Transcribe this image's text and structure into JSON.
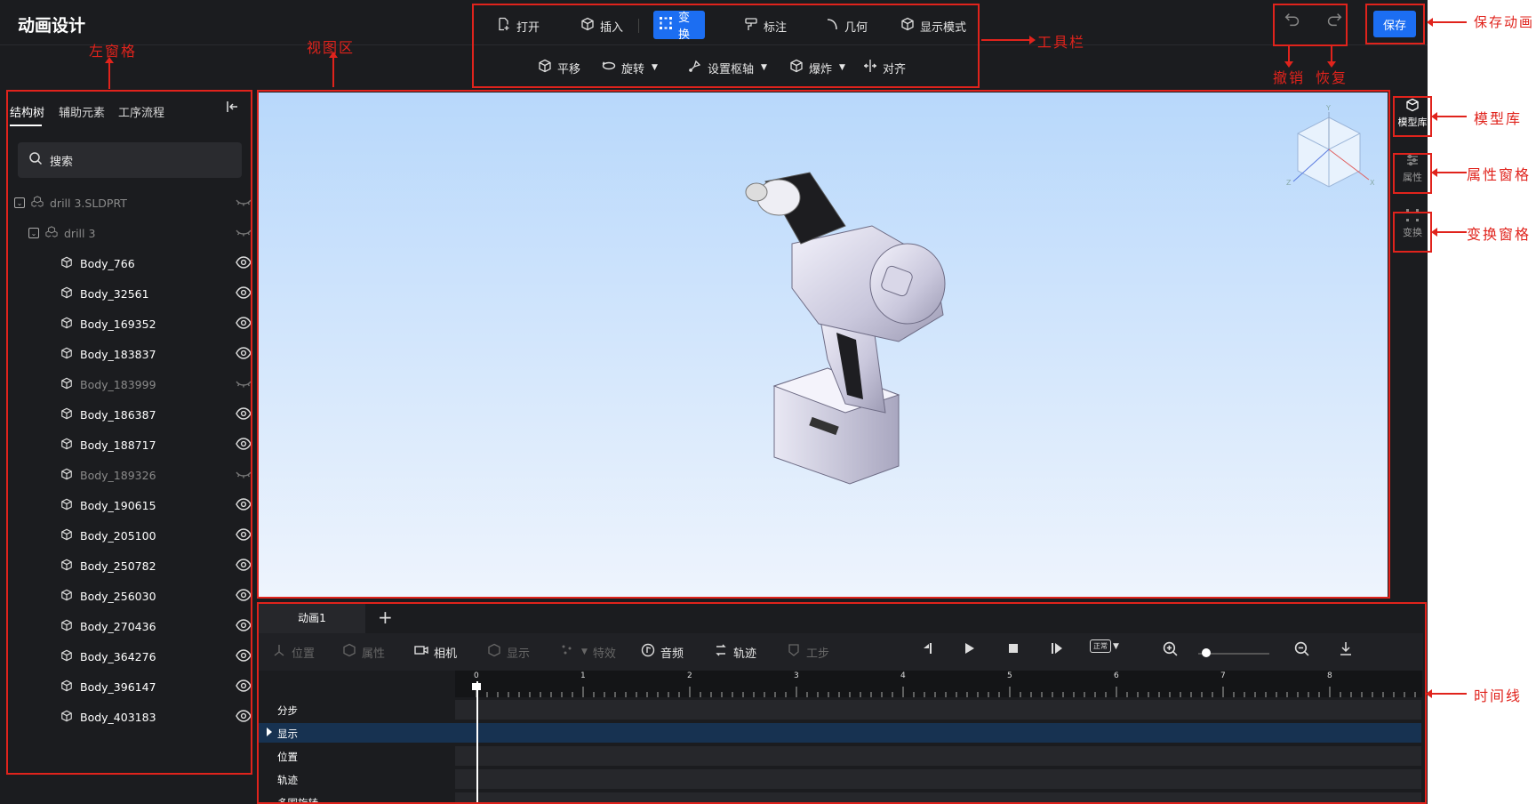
{
  "app": {
    "title": "动画设计"
  },
  "toolbar": {
    "row1": [
      {
        "label": "打开",
        "icon": "open-file-icon"
      },
      {
        "label": "插入",
        "icon": "cube-insert-icon"
      },
      {
        "label": "变换",
        "icon": "transform-icon",
        "active": true
      },
      {
        "label": "标注",
        "icon": "paint-annotate-icon"
      },
      {
        "label": "几何",
        "icon": "geometry-arc-icon"
      },
      {
        "label": "显示模式",
        "icon": "display-mode-icon"
      }
    ],
    "row2": [
      {
        "label": "平移",
        "icon": "translate-icon"
      },
      {
        "label": "旋转",
        "icon": "rotate-icon",
        "dropdown": true
      },
      {
        "label": "设置枢轴",
        "icon": "pivot-icon",
        "dropdown": true
      },
      {
        "label": "爆炸",
        "icon": "explode-icon",
        "dropdown": true
      },
      {
        "label": "对齐",
        "icon": "align-icon"
      }
    ],
    "save_label": "保存"
  },
  "left_panel": {
    "tabs": [
      "结构树",
      "辅助元素",
      "工序流程"
    ],
    "search_placeholder": "搜索",
    "tree": [
      {
        "label": "drill 3.SLDPRT",
        "level": 0,
        "dim": true,
        "hidden": true
      },
      {
        "label": "drill 3",
        "level": 1,
        "dim": true,
        "hidden": true
      },
      {
        "label": "Body_766",
        "level": 2,
        "hidden": false
      },
      {
        "label": "Body_32561",
        "level": 2,
        "hidden": false
      },
      {
        "label": "Body_169352",
        "level": 2,
        "hidden": false
      },
      {
        "label": "Body_183837",
        "level": 2,
        "hidden": false
      },
      {
        "label": "Body_183999",
        "level": 2,
        "dim": true,
        "hidden": true
      },
      {
        "label": "Body_186387",
        "level": 2,
        "hidden": false
      },
      {
        "label": "Body_188717",
        "level": 2,
        "hidden": false
      },
      {
        "label": "Body_189326",
        "level": 2,
        "dim": true,
        "hidden": true
      },
      {
        "label": "Body_190615",
        "level": 2,
        "hidden": false
      },
      {
        "label": "Body_205100",
        "level": 2,
        "hidden": false
      },
      {
        "label": "Body_250782",
        "level": 2,
        "hidden": false
      },
      {
        "label": "Body_256030",
        "level": 2,
        "hidden": false
      },
      {
        "label": "Body_270436",
        "level": 2,
        "hidden": false
      },
      {
        "label": "Body_364276",
        "level": 2,
        "hidden": false
      },
      {
        "label": "Body_396147",
        "level": 2,
        "hidden": false
      },
      {
        "label": "Body_403183",
        "level": 2,
        "hidden": false
      }
    ]
  },
  "right_panel": [
    {
      "label": "模型库",
      "icon": "model-library-icon",
      "active": true
    },
    {
      "label": "属性",
      "icon": "properties-icon"
    },
    {
      "label": "变换",
      "icon": "transform-panel-icon"
    }
  ],
  "timeline": {
    "tab": "动画1",
    "tools": [
      {
        "label": "位置",
        "icon": "position-icon",
        "enabled": false
      },
      {
        "label": "属性",
        "icon": "attribute-icon",
        "enabled": false
      },
      {
        "label": "相机",
        "icon": "camera-icon",
        "enabled": true
      },
      {
        "label": "显示",
        "icon": "display-icon",
        "enabled": false
      },
      {
        "label": "特效",
        "icon": "effects-icon",
        "enabled": false
      },
      {
        "label": "音频",
        "icon": "audio-icon",
        "enabled": true
      },
      {
        "label": "轨迹",
        "icon": "trajectory-icon",
        "enabled": true
      },
      {
        "label": "工步",
        "icon": "step-icon",
        "enabled": false
      }
    ],
    "speed_label": "正常",
    "ruler_ticks": [
      "0",
      "1",
      "2",
      "3",
      "4",
      "5",
      "6",
      "7",
      "8"
    ],
    "tracks": [
      {
        "label": "分步",
        "selected": false
      },
      {
        "label": "显示",
        "selected": true,
        "expandable": true
      },
      {
        "label": "位置",
        "selected": false
      },
      {
        "label": "轨迹",
        "selected": false
      },
      {
        "label": "多圈旋转",
        "selected": false
      }
    ]
  },
  "annotations": {
    "left_pane": "左窗格",
    "view_area": "视图区",
    "toolbar": "工具栏",
    "undo": "撤销",
    "redo": "恢复",
    "save_animation": "保存动画",
    "model_library": "模型库",
    "properties_pane": "属性窗格",
    "transform_pane": "变换窗格",
    "timeline": "时间线"
  },
  "colors": {
    "accent": "#1c6ef2",
    "annotation": "#e0231c",
    "background": "#1b1c1f"
  }
}
